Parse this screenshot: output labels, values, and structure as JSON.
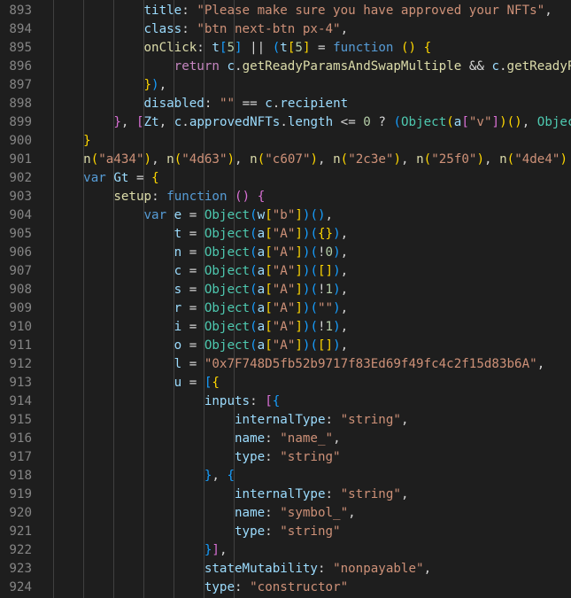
{
  "editor": {
    "language": "javascript",
    "indent_unit": "    ",
    "lines": [
      {
        "num": "893",
        "indent": 4,
        "tokens": [
          [
            "v",
            "title"
          ],
          [
            "p",
            ": "
          ],
          [
            "s",
            "\"Please make sure you have approved your NFTs\""
          ],
          [
            "p",
            ","
          ]
        ]
      },
      {
        "num": "894",
        "indent": 4,
        "tokens": [
          [
            "v",
            "class"
          ],
          [
            "p",
            ": "
          ],
          [
            "s",
            "\"btn next-btn px-4\""
          ],
          [
            "p",
            ","
          ]
        ]
      },
      {
        "num": "895",
        "indent": 4,
        "tokens": [
          [
            "f",
            "onClick"
          ],
          [
            "p",
            ": "
          ],
          [
            "v",
            "t"
          ],
          [
            "b3",
            "["
          ],
          [
            "n",
            "5"
          ],
          [
            "b3",
            "]"
          ],
          [
            "p",
            " || "
          ],
          [
            "b3",
            "("
          ],
          [
            "v",
            "t"
          ],
          [
            "b1",
            "["
          ],
          [
            "n",
            "5"
          ],
          [
            "b1",
            "]"
          ],
          [
            "p",
            " = "
          ],
          [
            "k",
            "function"
          ],
          [
            "p",
            " "
          ],
          [
            "b1",
            "("
          ],
          [
            "b1",
            ")"
          ],
          [
            "p",
            " "
          ],
          [
            "b1",
            "{"
          ]
        ]
      },
      {
        "num": "896",
        "indent": 5,
        "tokens": [
          [
            "c",
            "return"
          ],
          [
            "p",
            " "
          ],
          [
            "v",
            "c"
          ],
          [
            "p",
            "."
          ],
          [
            "f",
            "getReadyParamsAndSwapMultiple"
          ],
          [
            "p",
            " && "
          ],
          [
            "v",
            "c"
          ],
          [
            "p",
            "."
          ],
          [
            "f",
            "getReadyParamsAndSwapMultiple"
          ]
        ]
      },
      {
        "num": "897",
        "indent": 4,
        "tokens": [
          [
            "b1",
            "}"
          ],
          [
            "b3",
            ")"
          ],
          [
            "p",
            ","
          ]
        ]
      },
      {
        "num": "898",
        "indent": 4,
        "tokens": [
          [
            "v",
            "disabled"
          ],
          [
            "p",
            ": "
          ],
          [
            "s",
            "\"\""
          ],
          [
            "p",
            " == "
          ],
          [
            "v",
            "c"
          ],
          [
            "p",
            "."
          ],
          [
            "v",
            "recipient"
          ]
        ]
      },
      {
        "num": "899",
        "indent": 3,
        "tokens": [
          [
            "b2",
            "}"
          ],
          [
            "p",
            ", "
          ],
          [
            "b2",
            "["
          ],
          [
            "v",
            "Zt"
          ],
          [
            "p",
            ", "
          ],
          [
            "v",
            "c"
          ],
          [
            "p",
            "."
          ],
          [
            "v",
            "approvedNFTs"
          ],
          [
            "p",
            "."
          ],
          [
            "v",
            "length"
          ],
          [
            "p",
            " <= "
          ],
          [
            "n",
            "0"
          ],
          [
            "p",
            " ? "
          ],
          [
            "b3",
            "("
          ],
          [
            "t",
            "Object"
          ],
          [
            "b1",
            "("
          ],
          [
            "v",
            "a"
          ],
          [
            "b2",
            "["
          ],
          [
            "s",
            "\"v\""
          ],
          [
            "b2",
            "]"
          ],
          [
            "b1",
            ")"
          ],
          [
            "b1",
            "("
          ],
          [
            "b1",
            ")"
          ],
          [
            "p",
            ", "
          ],
          [
            "t",
            "Object"
          ],
          [
            "b1",
            "("
          ]
        ]
      },
      {
        "num": "900",
        "indent": 2,
        "tokens": [
          [
            "b1",
            "}"
          ]
        ]
      },
      {
        "num": "901",
        "indent": 2,
        "tokens": [
          [
            "f",
            "n"
          ],
          [
            "b1",
            "("
          ],
          [
            "s",
            "\"a434\""
          ],
          [
            "b1",
            ")"
          ],
          [
            "p",
            ", "
          ],
          [
            "f",
            "n"
          ],
          [
            "b1",
            "("
          ],
          [
            "s",
            "\"4d63\""
          ],
          [
            "b1",
            ")"
          ],
          [
            "p",
            ", "
          ],
          [
            "f",
            "n"
          ],
          [
            "b1",
            "("
          ],
          [
            "s",
            "\"c607\""
          ],
          [
            "b1",
            ")"
          ],
          [
            "p",
            ", "
          ],
          [
            "f",
            "n"
          ],
          [
            "b1",
            "("
          ],
          [
            "s",
            "\"2c3e\""
          ],
          [
            "b1",
            ")"
          ],
          [
            "p",
            ", "
          ],
          [
            "f",
            "n"
          ],
          [
            "b1",
            "("
          ],
          [
            "s",
            "\"25f0\""
          ],
          [
            "b1",
            ")"
          ],
          [
            "p",
            ", "
          ],
          [
            "f",
            "n"
          ],
          [
            "b1",
            "("
          ],
          [
            "s",
            "\"4de4\""
          ],
          [
            "b1",
            ")"
          ]
        ]
      },
      {
        "num": "902",
        "indent": 2,
        "tokens": [
          [
            "k",
            "var"
          ],
          [
            "p",
            " "
          ],
          [
            "v",
            "Gt"
          ],
          [
            "p",
            " = "
          ],
          [
            "b1",
            "{"
          ]
        ]
      },
      {
        "num": "903",
        "indent": 3,
        "tokens": [
          [
            "f",
            "setup"
          ],
          [
            "p",
            ": "
          ],
          [
            "k",
            "function"
          ],
          [
            "p",
            " "
          ],
          [
            "b2",
            "("
          ],
          [
            "b2",
            ")"
          ],
          [
            "p",
            " "
          ],
          [
            "b2",
            "{"
          ]
        ]
      },
      {
        "num": "904",
        "indent": 4,
        "tokens": [
          [
            "k",
            "var"
          ],
          [
            "p",
            " "
          ],
          [
            "v",
            "e"
          ],
          [
            "p",
            " = "
          ],
          [
            "t",
            "Object"
          ],
          [
            "b3",
            "("
          ],
          [
            "v",
            "w"
          ],
          [
            "b1",
            "["
          ],
          [
            "s",
            "\"b\""
          ],
          [
            "b1",
            "]"
          ],
          [
            "b3",
            ")"
          ],
          [
            "b3",
            "("
          ],
          [
            "b3",
            ")"
          ],
          [
            "p",
            ","
          ]
        ]
      },
      {
        "num": "905",
        "indent": 5,
        "tokens": [
          [
            "v",
            "t"
          ],
          [
            "p",
            " = "
          ],
          [
            "t",
            "Object"
          ],
          [
            "b3",
            "("
          ],
          [
            "v",
            "a"
          ],
          [
            "b1",
            "["
          ],
          [
            "s",
            "\"A\""
          ],
          [
            "b1",
            "]"
          ],
          [
            "b3",
            ")"
          ],
          [
            "b3",
            "("
          ],
          [
            "b1",
            "{"
          ],
          [
            "b1",
            "}"
          ],
          [
            "b3",
            ")"
          ],
          [
            "p",
            ","
          ]
        ]
      },
      {
        "num": "906",
        "indent": 5,
        "tokens": [
          [
            "v",
            "n"
          ],
          [
            "p",
            " = "
          ],
          [
            "t",
            "Object"
          ],
          [
            "b3",
            "("
          ],
          [
            "v",
            "a"
          ],
          [
            "b1",
            "["
          ],
          [
            "s",
            "\"A\""
          ],
          [
            "b1",
            "]"
          ],
          [
            "b3",
            ")"
          ],
          [
            "b3",
            "("
          ],
          [
            "p",
            "!"
          ],
          [
            "n",
            "0"
          ],
          [
            "b3",
            ")"
          ],
          [
            "p",
            ","
          ]
        ]
      },
      {
        "num": "907",
        "indent": 5,
        "tokens": [
          [
            "v",
            "c"
          ],
          [
            "p",
            " = "
          ],
          [
            "t",
            "Object"
          ],
          [
            "b3",
            "("
          ],
          [
            "v",
            "a"
          ],
          [
            "b1",
            "["
          ],
          [
            "s",
            "\"A\""
          ],
          [
            "b1",
            "]"
          ],
          [
            "b3",
            ")"
          ],
          [
            "b3",
            "("
          ],
          [
            "b1",
            "["
          ],
          [
            "b1",
            "]"
          ],
          [
            "b3",
            ")"
          ],
          [
            "p",
            ","
          ]
        ]
      },
      {
        "num": "908",
        "indent": 5,
        "tokens": [
          [
            "v",
            "s"
          ],
          [
            "p",
            " = "
          ],
          [
            "t",
            "Object"
          ],
          [
            "b3",
            "("
          ],
          [
            "v",
            "a"
          ],
          [
            "b1",
            "["
          ],
          [
            "s",
            "\"A\""
          ],
          [
            "b1",
            "]"
          ],
          [
            "b3",
            ")"
          ],
          [
            "b3",
            "("
          ],
          [
            "p",
            "!"
          ],
          [
            "n",
            "1"
          ],
          [
            "b3",
            ")"
          ],
          [
            "p",
            ","
          ]
        ]
      },
      {
        "num": "909",
        "indent": 5,
        "tokens": [
          [
            "v",
            "r"
          ],
          [
            "p",
            " = "
          ],
          [
            "t",
            "Object"
          ],
          [
            "b3",
            "("
          ],
          [
            "v",
            "a"
          ],
          [
            "b1",
            "["
          ],
          [
            "s",
            "\"A\""
          ],
          [
            "b1",
            "]"
          ],
          [
            "b3",
            ")"
          ],
          [
            "b3",
            "("
          ],
          [
            "s",
            "\"\""
          ],
          [
            "b3",
            ")"
          ],
          [
            "p",
            ","
          ]
        ]
      },
      {
        "num": "910",
        "indent": 5,
        "tokens": [
          [
            "v",
            "i"
          ],
          [
            "p",
            " = "
          ],
          [
            "t",
            "Object"
          ],
          [
            "b3",
            "("
          ],
          [
            "v",
            "a"
          ],
          [
            "b1",
            "["
          ],
          [
            "s",
            "\"A\""
          ],
          [
            "b1",
            "]"
          ],
          [
            "b3",
            ")"
          ],
          [
            "b3",
            "("
          ],
          [
            "p",
            "!"
          ],
          [
            "n",
            "1"
          ],
          [
            "b3",
            ")"
          ],
          [
            "p",
            ","
          ]
        ]
      },
      {
        "num": "911",
        "indent": 5,
        "tokens": [
          [
            "v",
            "o"
          ],
          [
            "p",
            " = "
          ],
          [
            "t",
            "Object"
          ],
          [
            "b3",
            "("
          ],
          [
            "v",
            "a"
          ],
          [
            "b1",
            "["
          ],
          [
            "s",
            "\"A\""
          ],
          [
            "b1",
            "]"
          ],
          [
            "b3",
            ")"
          ],
          [
            "b3",
            "("
          ],
          [
            "b1",
            "["
          ],
          [
            "b1",
            "]"
          ],
          [
            "b3",
            ")"
          ],
          [
            "p",
            ","
          ]
        ]
      },
      {
        "num": "912",
        "indent": 5,
        "tokens": [
          [
            "v",
            "l"
          ],
          [
            "p",
            " = "
          ],
          [
            "s",
            "\"0x7F748D5fb52b9717f83Ed69f49fc4c2f15d83b6A\""
          ],
          [
            "p",
            ","
          ]
        ]
      },
      {
        "num": "913",
        "indent": 5,
        "tokens": [
          [
            "v",
            "u"
          ],
          [
            "p",
            " = "
          ],
          [
            "b3",
            "["
          ],
          [
            "b1",
            "{"
          ]
        ]
      },
      {
        "num": "914",
        "indent": 6,
        "tokens": [
          [
            "v",
            "inputs"
          ],
          [
            "p",
            ": "
          ],
          [
            "b2",
            "["
          ],
          [
            "b3",
            "{"
          ]
        ]
      },
      {
        "num": "915",
        "indent": 7,
        "tokens": [
          [
            "v",
            "internalType"
          ],
          [
            "p",
            ": "
          ],
          [
            "s",
            "\"string\""
          ],
          [
            "p",
            ","
          ]
        ]
      },
      {
        "num": "916",
        "indent": 7,
        "tokens": [
          [
            "v",
            "name"
          ],
          [
            "p",
            ": "
          ],
          [
            "s",
            "\"name_\""
          ],
          [
            "p",
            ","
          ]
        ]
      },
      {
        "num": "917",
        "indent": 7,
        "tokens": [
          [
            "v",
            "type"
          ],
          [
            "p",
            ": "
          ],
          [
            "s",
            "\"string\""
          ]
        ]
      },
      {
        "num": "918",
        "indent": 6,
        "tokens": [
          [
            "b3",
            "}"
          ],
          [
            "p",
            ", "
          ],
          [
            "b3",
            "{"
          ]
        ]
      },
      {
        "num": "919",
        "indent": 7,
        "tokens": [
          [
            "v",
            "internalType"
          ],
          [
            "p",
            ": "
          ],
          [
            "s",
            "\"string\""
          ],
          [
            "p",
            ","
          ]
        ]
      },
      {
        "num": "920",
        "indent": 7,
        "tokens": [
          [
            "v",
            "name"
          ],
          [
            "p",
            ": "
          ],
          [
            "s",
            "\"symbol_\""
          ],
          [
            "p",
            ","
          ]
        ]
      },
      {
        "num": "921",
        "indent": 7,
        "tokens": [
          [
            "v",
            "type"
          ],
          [
            "p",
            ": "
          ],
          [
            "s",
            "\"string\""
          ]
        ]
      },
      {
        "num": "922",
        "indent": 6,
        "tokens": [
          [
            "b3",
            "}"
          ],
          [
            "b2",
            "]"
          ],
          [
            "p",
            ","
          ]
        ]
      },
      {
        "num": "923",
        "indent": 6,
        "tokens": [
          [
            "v",
            "stateMutability"
          ],
          [
            "p",
            ": "
          ],
          [
            "s",
            "\"nonpayable\""
          ],
          [
            "p",
            ","
          ]
        ]
      },
      {
        "num": "924",
        "indent": 6,
        "tokens": [
          [
            "v",
            "type"
          ],
          [
            "p",
            ": "
          ],
          [
            "s",
            "\"constructor\""
          ]
        ]
      }
    ]
  },
  "theme": {
    "background": "#1e1e1e",
    "line_number": "#858585",
    "keyword": "#569cd6",
    "control": "#c586c0",
    "string": "#ce9178",
    "number": "#b5cea8",
    "function": "#dcdcaa",
    "variable": "#9cdcfe",
    "type": "#4ec9b0"
  }
}
